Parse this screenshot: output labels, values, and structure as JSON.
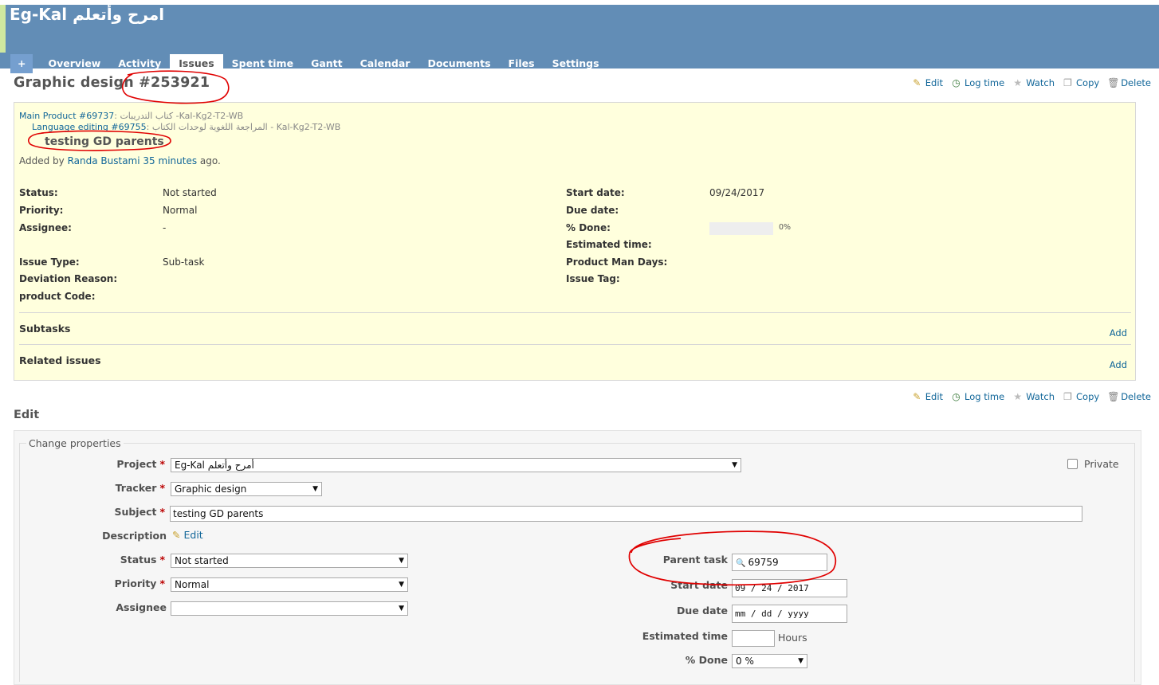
{
  "header": {
    "project_title": "Eg-Kal امرح وأتعلم",
    "tabs": [
      {
        "label": "+"
      },
      {
        "label": "Overview"
      },
      {
        "label": "Activity"
      },
      {
        "label": "Issues"
      },
      {
        "label": "Spent time"
      },
      {
        "label": "Gantt"
      },
      {
        "label": "Calendar"
      },
      {
        "label": "Documents"
      },
      {
        "label": "Files"
      },
      {
        "label": "Settings"
      }
    ],
    "selected_tab": "Issues"
  },
  "issue": {
    "title": "Graphic design #253921",
    "parent1_link": "Main Product #69737",
    "parent1_text": ": كتاب التدريبات -Kal-Kg2-T2-WB",
    "parent2_link": "Language editing #69755",
    "parent2_text": ": المراجعة اللغوية لوحدات الكتاب - Kal-Kg2-T2-WB",
    "subject": "testing GD parents",
    "added_by_prefix": "Added by",
    "author": "Randa Bustami",
    "time_ago": "35 minutes",
    "added_by_suffix": "ago.",
    "attributes_left": [
      {
        "label": "Status:",
        "value": "Not started"
      },
      {
        "label": "Priority:",
        "value": "Normal"
      },
      {
        "label": "Assignee:",
        "value": "-"
      },
      {
        "label": "Issue Type:",
        "value": "Sub-task"
      },
      {
        "label": "Deviation Reason:",
        "value": ""
      },
      {
        "label": "product Code:",
        "value": ""
      }
    ],
    "attributes_right": [
      {
        "label": "Start date:",
        "value": "09/24/2017"
      },
      {
        "label": "Due date:",
        "value": ""
      },
      {
        "label": "% Done:",
        "value": "0%"
      },
      {
        "label": "Estimated time:",
        "value": ""
      },
      {
        "label": "Product Man Days:",
        "value": ""
      },
      {
        "label": "Issue Tag:",
        "value": ""
      }
    ],
    "done_ratio": 0,
    "subtasks_label": "Subtasks",
    "related_label": "Related issues",
    "add_label": "Add"
  },
  "contextual": {
    "edit": "Edit",
    "log_time": "Log time",
    "watch": "Watch",
    "copy": "Copy",
    "delete": "Delete"
  },
  "edit_form": {
    "heading": "Edit",
    "legend": "Change properties",
    "project_label": "Project",
    "project_value": "Eg-Kal أمرح وأتعلم",
    "private_label": "Private",
    "tracker_label": "Tracker",
    "tracker_value": "Graphic design",
    "subject_label": "Subject",
    "subject_value": "testing GD parents",
    "description_label": "Description",
    "description_edit": "Edit",
    "status_label": "Status",
    "status_value": "Not started",
    "priority_label": "Priority",
    "priority_value": "Normal",
    "assignee_label": "Assignee",
    "assignee_value": "",
    "parent_task_label": "Parent task",
    "parent_task_value": "69759",
    "start_date_label": "Start date",
    "start_date_value": "09 / 24 / 2017",
    "due_date_label": "Due date",
    "due_date_placeholder": "mm / dd / yyyy",
    "estimated_time_label": "Estimated time",
    "estimated_time_value": "",
    "hours_label": "Hours",
    "done_label": "% Done",
    "done_value": "0 %",
    "required_mark": "*"
  },
  "colors": {
    "header_bg": "#628DB6",
    "issue_bg": "#ffffdd",
    "link": "#169",
    "annotation_red": "#e00000"
  }
}
